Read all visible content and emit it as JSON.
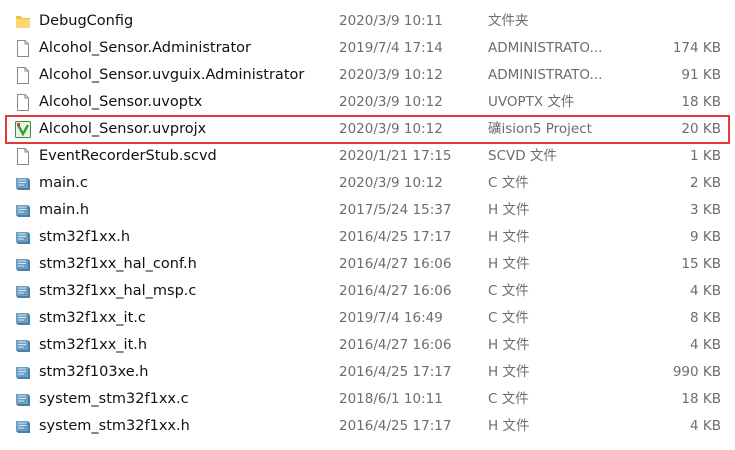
{
  "files": [
    {
      "name": "DebugConfig",
      "date": "2020/3/9 10:11",
      "type": "文件夹",
      "size": "",
      "icon": "folder-icon"
    },
    {
      "name": "Alcohol_Sensor.Administrator",
      "date": "2019/7/4 17:14",
      "type": "ADMINISTRATO...",
      "size": "174 KB",
      "icon": "file-icon"
    },
    {
      "name": "Alcohol_Sensor.uvguix.Administrator",
      "date": "2020/3/9 10:12",
      "type": "ADMINISTRATO...",
      "size": "91 KB",
      "icon": "file-icon"
    },
    {
      "name": "Alcohol_Sensor.uvoptx",
      "date": "2020/3/9 10:12",
      "type": "UVOPTX 文件",
      "size": "18 KB",
      "icon": "file-icon"
    },
    {
      "name": "Alcohol_Sensor.uvprojx",
      "date": "2020/3/9 10:12",
      "type": "礦ision5 Project",
      "size": "20 KB",
      "icon": "keil-project-icon"
    },
    {
      "name": "EventRecorderStub.scvd",
      "date": "2020/1/21 17:15",
      "type": "SCVD 文件",
      "size": "1 KB",
      "icon": "file-icon"
    },
    {
      "name": "main.c",
      "date": "2020/3/9 10:12",
      "type": "C 文件",
      "size": "2 KB",
      "icon": "source-file-icon"
    },
    {
      "name": "main.h",
      "date": "2017/5/24 15:37",
      "type": "H 文件",
      "size": "3 KB",
      "icon": "source-file-icon"
    },
    {
      "name": "stm32f1xx.h",
      "date": "2016/4/25 17:17",
      "type": "H 文件",
      "size": "9 KB",
      "icon": "source-file-icon"
    },
    {
      "name": "stm32f1xx_hal_conf.h",
      "date": "2016/4/27 16:06",
      "type": "H 文件",
      "size": "15 KB",
      "icon": "source-file-icon"
    },
    {
      "name": "stm32f1xx_hal_msp.c",
      "date": "2016/4/27 16:06",
      "type": "C 文件",
      "size": "4 KB",
      "icon": "source-file-icon"
    },
    {
      "name": "stm32f1xx_it.c",
      "date": "2019/7/4 16:49",
      "type": "C 文件",
      "size": "8 KB",
      "icon": "source-file-icon"
    },
    {
      "name": "stm32f1xx_it.h",
      "date": "2016/4/27 16:06",
      "type": "H 文件",
      "size": "4 KB",
      "icon": "source-file-icon"
    },
    {
      "name": "stm32f103xe.h",
      "date": "2016/4/25 17:17",
      "type": "H 文件",
      "size": "990 KB",
      "icon": "source-file-icon"
    },
    {
      "name": "system_stm32f1xx.c",
      "date": "2018/6/1 10:11",
      "type": "C 文件",
      "size": "18 KB",
      "icon": "source-file-icon"
    },
    {
      "name": "system_stm32f1xx.h",
      "date": "2016/4/25 17:17",
      "type": "H 文件",
      "size": "4 KB",
      "icon": "source-file-icon"
    }
  ],
  "selected_index": 4,
  "colors": {
    "selection_outline": "#e03a3a",
    "folder": "#f3c143",
    "source_icon": "#4a7fa8",
    "keil_green": "#3a9a3a"
  }
}
